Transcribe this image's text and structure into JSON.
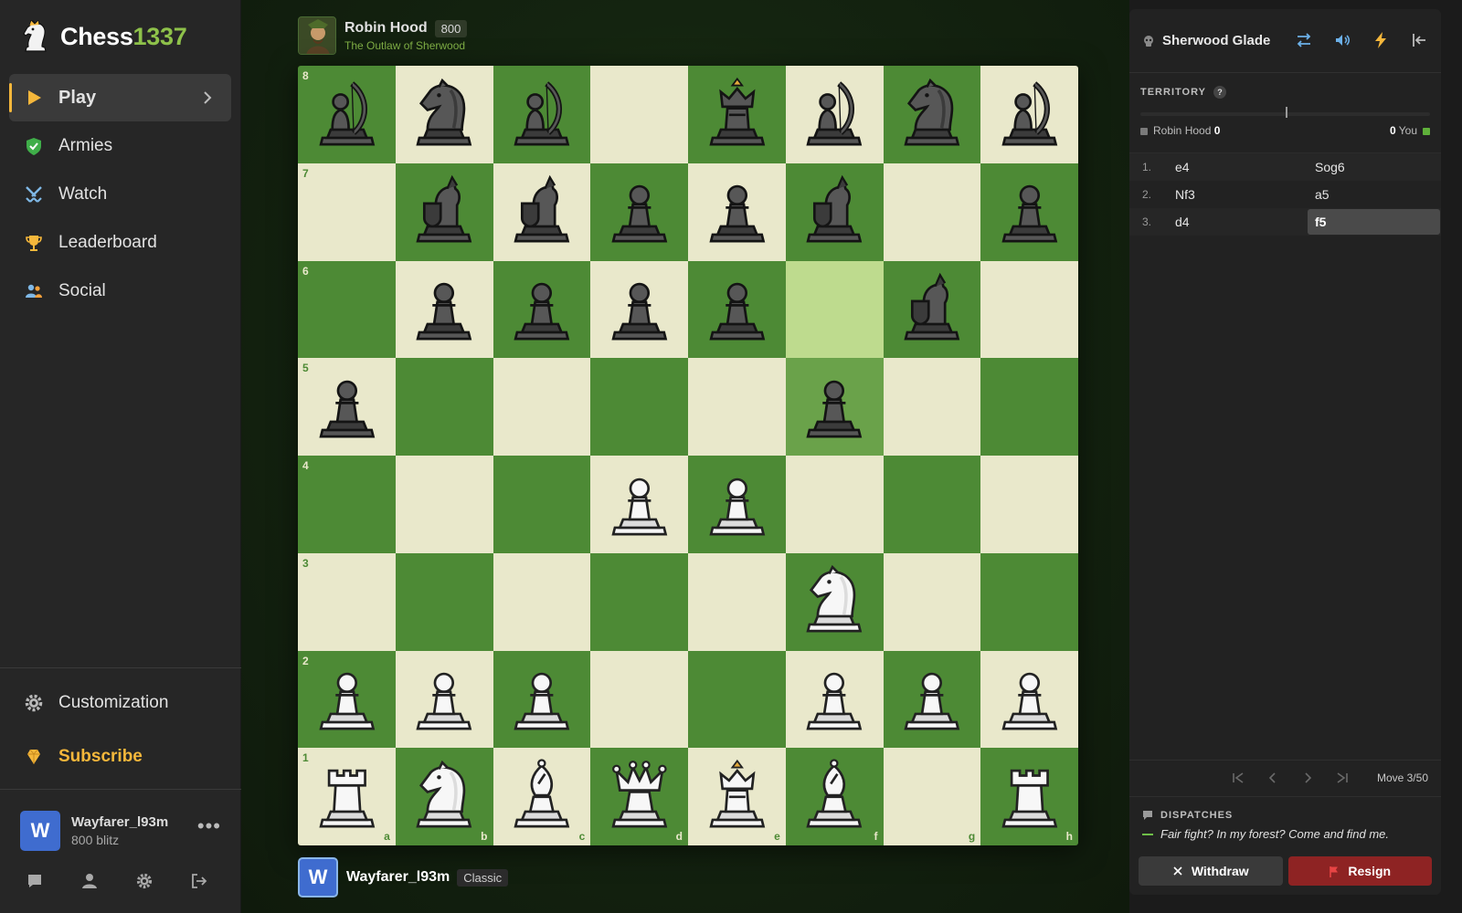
{
  "brand": {
    "name_main": "Chess",
    "name_accent": "1337"
  },
  "sidebar": {
    "nav": [
      {
        "key": "play",
        "label": "Play",
        "icon": "play-icon",
        "active": true
      },
      {
        "key": "armies",
        "label": "Armies",
        "icon": "shield-icon"
      },
      {
        "key": "watch",
        "label": "Watch",
        "icon": "swords-icon"
      },
      {
        "key": "leaderboard",
        "label": "Leaderboard",
        "icon": "trophy-icon"
      },
      {
        "key": "social",
        "label": "Social",
        "icon": "people-icon"
      }
    ],
    "customization_label": "Customization",
    "subscribe_label": "Subscribe",
    "user": {
      "initial": "W",
      "name": "Wayfarer_l93m",
      "rating": "800 blitz"
    }
  },
  "opponent": {
    "name": "Robin Hood",
    "rating": "800",
    "subtitle": "The Outlaw of Sherwood"
  },
  "me": {
    "initial": "W",
    "name": "Wayfarer_l93m",
    "mode": "Classic"
  },
  "board": {
    "orientation": "white",
    "highlight": [
      "f6",
      "f5"
    ],
    "colors": {
      "light": "#e9e8cb",
      "dark": "#4d8a35"
    },
    "pieces": {
      "a8": "b-archer",
      "b8": "b-knight",
      "c8": "b-archer",
      "e8": "b-king",
      "f8": "b-archer",
      "g8": "b-knight",
      "h8": "b-archer",
      "b7": "b-guard",
      "c7": "b-guard",
      "d7": "b-pawn",
      "e7": "b-pawn",
      "f7": "b-guard",
      "h7": "b-pawn",
      "b6": "b-pawn",
      "c6": "b-pawn",
      "d6": "b-pawn",
      "e6": "b-pawn",
      "g6": "b-guard",
      "a5": "b-pawn",
      "f5": "b-pawn",
      "d4": "w-pawn",
      "e4": "w-pawn",
      "f3": "w-knight",
      "a2": "w-pawn",
      "b2": "w-pawn",
      "c2": "w-pawn",
      "f2": "w-pawn",
      "g2": "w-pawn",
      "h2": "w-pawn",
      "a1": "w-rook",
      "b1": "w-knight",
      "c1": "w-bishop",
      "d1": "w-queen",
      "e1": "w-king",
      "f1": "w-bishop",
      "h1": "w-rook"
    }
  },
  "panel": {
    "title": "Sherwood Glade",
    "territory": {
      "label": "TERRITORY",
      "help": "?",
      "left_name": "Robin Hood",
      "left_score": "0",
      "right_score": "0",
      "right_name": "You",
      "balance": 0.5
    },
    "moves": [
      {
        "num": "1.",
        "white": "e4",
        "black": "Sog6"
      },
      {
        "num": "2.",
        "white": "Nf3",
        "black": "a5"
      },
      {
        "num": "3.",
        "white": "d4",
        "black": "f5"
      }
    ],
    "current_move": "3b",
    "move_counter": "Move 3/50",
    "dispatches": {
      "label": "DISPATCHES",
      "message": "Fair fight? In my forest? Come and find me."
    },
    "withdraw_label": "Withdraw",
    "resign_label": "Resign"
  },
  "colors": {
    "accent": "#8ec14a",
    "gold": "#f5b73b",
    "resign": "#8e2323",
    "user_blue": "#3f6ccf"
  }
}
